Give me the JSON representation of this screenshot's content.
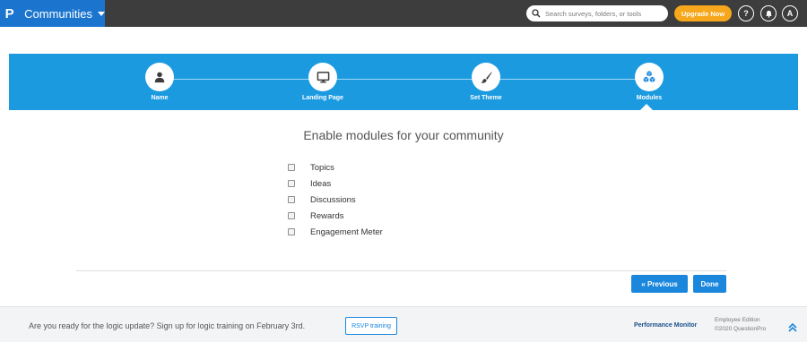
{
  "app": {
    "logo": "P",
    "title": "Communities"
  },
  "header": {
    "search_placeholder": "Search surveys, folders, or tools",
    "upgrade_label": "Upgrade Now",
    "help_glyph": "?",
    "avatar_initial": "A"
  },
  "stepper": {
    "steps": [
      {
        "label": "Name",
        "icon": "user-icon"
      },
      {
        "label": "Landing Page",
        "icon": "monitor-icon"
      },
      {
        "label": "Set Theme",
        "icon": "paintbrush-icon"
      },
      {
        "label": "Modules",
        "icon": "cubes-icon",
        "active": true
      }
    ]
  },
  "main": {
    "heading": "Enable modules for your community",
    "modules": [
      "Topics",
      "Ideas",
      "Discussions",
      "Rewards",
      "Engagement Meter"
    ],
    "previous_label": "« Previous",
    "done_label": "Done"
  },
  "footer": {
    "promo_text": "Are you ready for the logic update? Sign up for logic training on February 3rd.",
    "rsvp_label": "RSVP training",
    "performance_label": "Performance Monitor",
    "edition_line1": "Employee Edition",
    "edition_line2": "©2020 QuestionPro"
  },
  "colors": {
    "brand_blue": "#1b75cf",
    "stepper_blue": "#1b9ae0",
    "button_blue": "#1b87dc",
    "upgrade_orange": "#f7a71b",
    "topbar": "#3d3d3d"
  }
}
